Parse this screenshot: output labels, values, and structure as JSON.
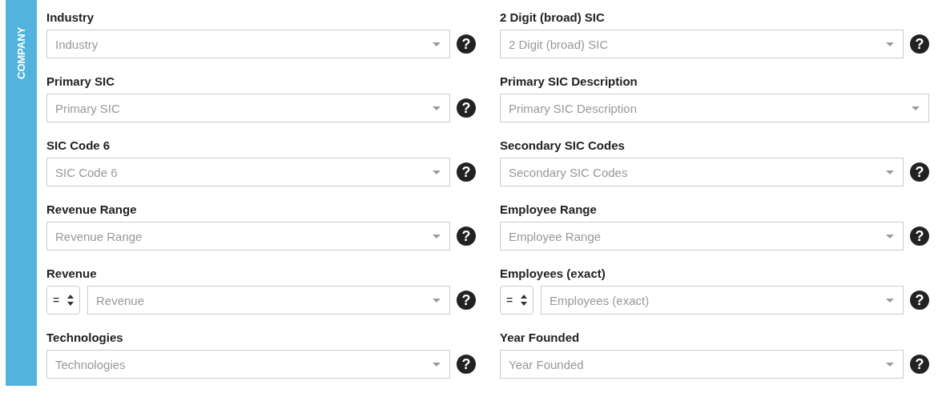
{
  "section": {
    "title": "COMPANY"
  },
  "columns": [
    {
      "fields": [
        {
          "label": "Industry",
          "kind": "select",
          "placeholder": "Industry",
          "help": "?"
        },
        {
          "label": "Primary SIC",
          "kind": "select",
          "placeholder": "Primary SIC",
          "help": "?"
        },
        {
          "label": "SIC Code 6",
          "kind": "select",
          "placeholder": "SIC Code 6",
          "help": "?"
        },
        {
          "label": "Revenue Range",
          "kind": "select",
          "placeholder": "Revenue Range",
          "help": "?"
        },
        {
          "label": "Revenue",
          "kind": "operator-select",
          "operator": "=",
          "placeholder": "Revenue",
          "help": "?"
        },
        {
          "label": "Technologies",
          "kind": "select",
          "placeholder": "Technologies",
          "help": "?"
        }
      ]
    },
    {
      "fields": [
        {
          "label": "2 Digit (broad) SIC",
          "kind": "select",
          "placeholder": "2 Digit (broad) SIC",
          "help": "?"
        },
        {
          "label": "Primary SIC Description",
          "kind": "select",
          "placeholder": "Primary SIC Description"
        },
        {
          "label": "Secondary SIC Codes",
          "kind": "select",
          "placeholder": "Secondary SIC Codes",
          "help": "?"
        },
        {
          "label": "Employee Range",
          "kind": "select",
          "placeholder": "Employee Range",
          "help": "?"
        },
        {
          "label": "Employees (exact)",
          "kind": "operator-select",
          "operator": "=",
          "placeholder": "Employees (exact)",
          "help": "?"
        },
        {
          "label": "Year Founded",
          "kind": "select",
          "placeholder": "Year Founded",
          "help": "?"
        }
      ]
    }
  ]
}
